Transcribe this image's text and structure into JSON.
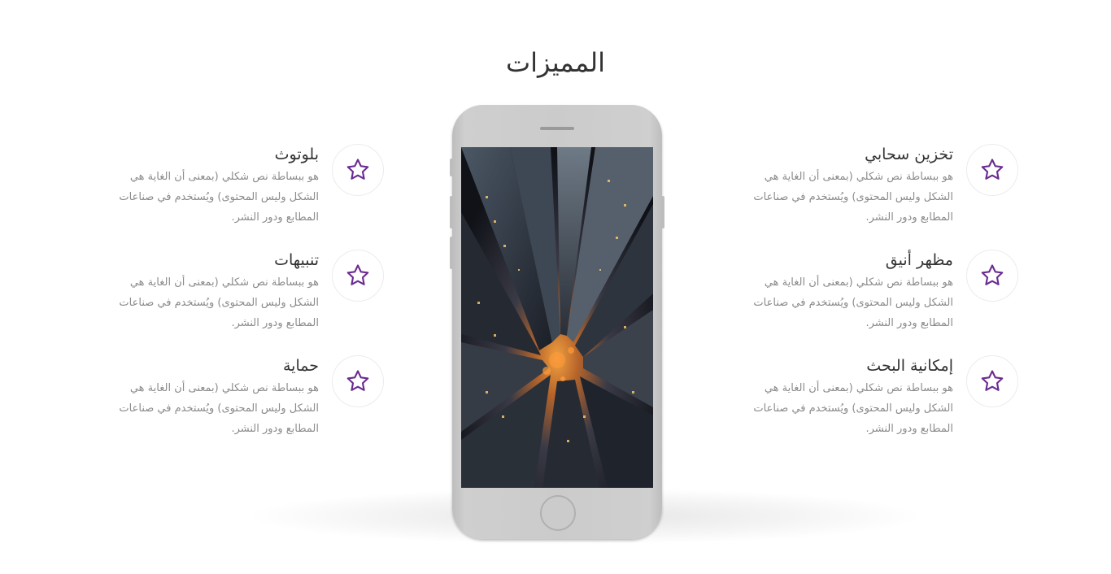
{
  "section": {
    "title": "المميزات"
  },
  "icon": {
    "name": "star-icon",
    "color": "#6b2c91"
  },
  "features_right": [
    {
      "title": "تخزين سحابي",
      "desc": [
        "هو ببساطة نص شكلي (بمعنى أن الغاية هي",
        "الشكل وليس المحتوى) ويُستخدم في صناعات",
        "المطابع ودور النشر."
      ]
    },
    {
      "title": "مظهر أنيق",
      "desc": [
        "هو ببساطة نص شكلي (بمعنى أن الغاية هي",
        "الشكل وليس المحتوى) ويُستخدم في صناعات",
        "المطابع ودور النشر."
      ]
    },
    {
      "title": "إمكانية البحث",
      "desc": [
        "هو ببساطة نص شكلي (بمعنى أن الغاية هي",
        "الشكل وليس المحتوى) ويُستخدم في صناعات",
        "المطابع ودور النشر."
      ]
    }
  ],
  "features_left": [
    {
      "title": "بلوتوث",
      "desc": [
        "هو ببساطة نص شكلي (بمعنى أن الغاية هي",
        "الشكل وليس المحتوى) ويُستخدم في صناعات",
        "المطابع ودور النشر."
      ]
    },
    {
      "title": "تنبيهات",
      "desc": [
        "هو ببساطة نص شكلي (بمعنى أن الغاية هي",
        "الشكل وليس المحتوى) ويُستخدم في صناعات",
        "المطابع ودور النشر."
      ]
    },
    {
      "title": "حماية",
      "desc": [
        "هو ببساطة نص شكلي (بمعنى أن الغاية هي",
        "الشكل وليس المحتوى) ويُستخدم في صناعات",
        "المطابع ودور النشر."
      ]
    }
  ],
  "phone": {
    "screen_image": "city-aerial-skyscrapers"
  }
}
